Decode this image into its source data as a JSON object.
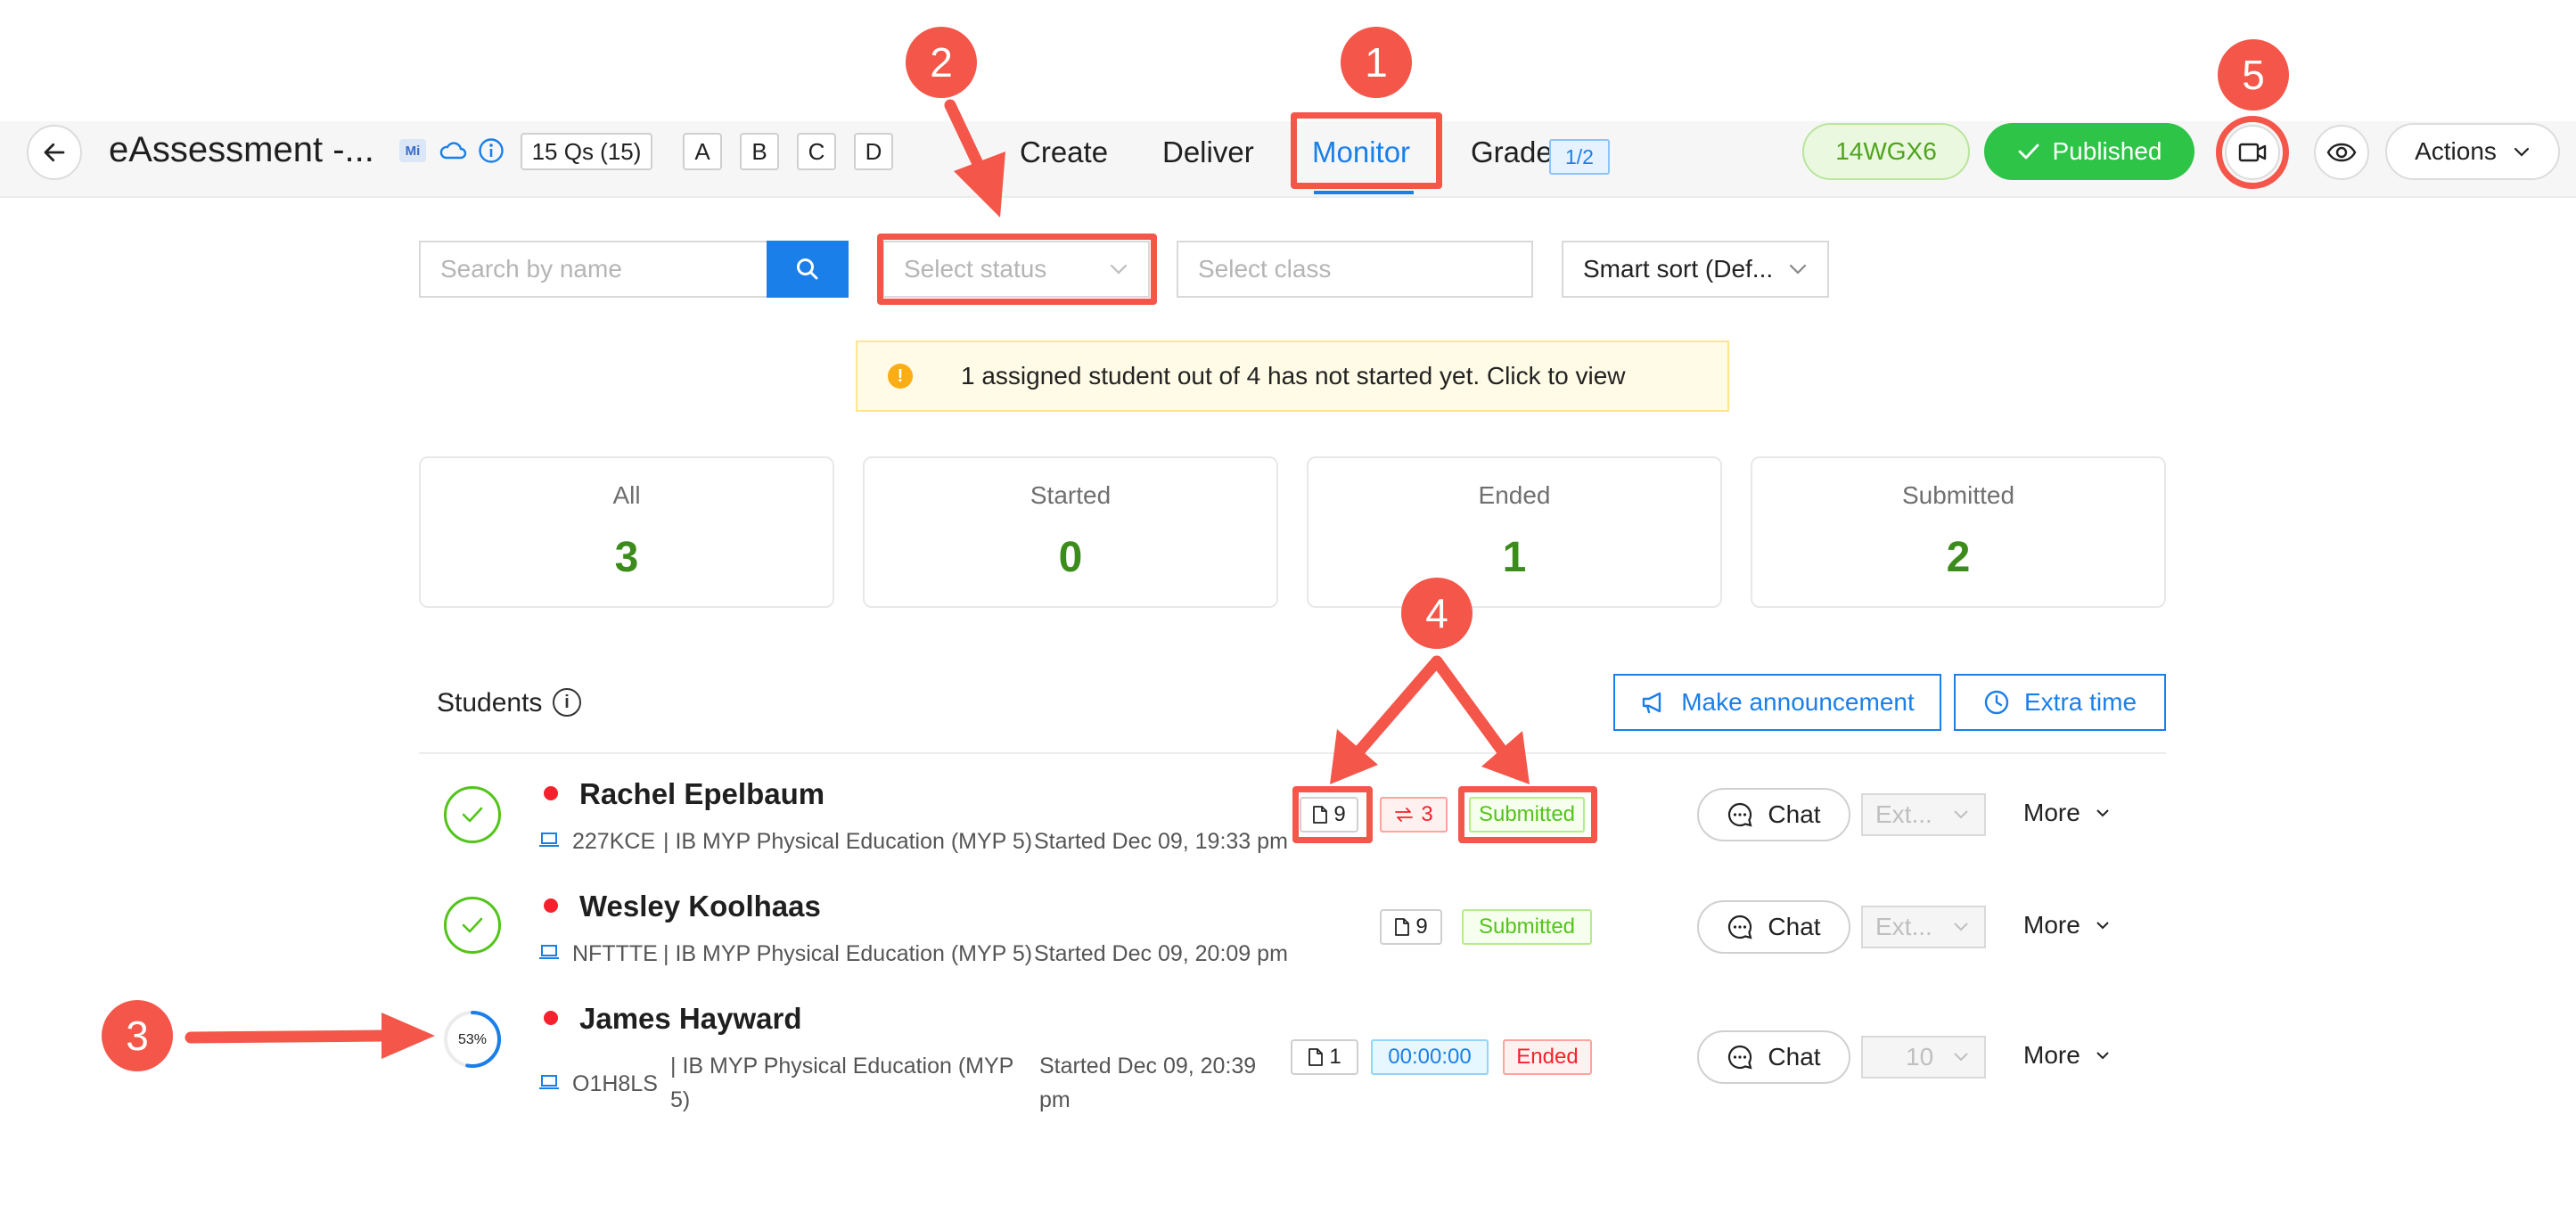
{
  "header": {
    "title": "eAssessment -...",
    "mi_badge": "Mi",
    "questions_chip": "15 Qs (15)",
    "choices": [
      "A",
      "B",
      "C",
      "D"
    ],
    "tabs": [
      {
        "label": "Create",
        "active": false
      },
      {
        "label": "Deliver",
        "active": false
      },
      {
        "label": "Monitor",
        "active": true
      },
      {
        "label": "Grade",
        "active": false
      }
    ],
    "grade_badge": "1/2",
    "code": "14WGX6",
    "published_label": "Published",
    "actions_label": "Actions"
  },
  "filters": {
    "search_placeholder": "Search by name",
    "status_placeholder": "Select status",
    "class_placeholder": "Select class",
    "sort_value": "Smart sort (Def..."
  },
  "notice": {
    "icon": "!",
    "text": "1 assigned student out of 4 has not started yet. Click to view"
  },
  "stats": [
    {
      "label": "All",
      "value": "3"
    },
    {
      "label": "Started",
      "value": "0"
    },
    {
      "label": "Ended",
      "value": "1"
    },
    {
      "label": "Submitted",
      "value": "2"
    }
  ],
  "students_section": {
    "title": "Students",
    "info_icon": "i",
    "announcement_label": "Make announcement",
    "extra_time_label": "Extra time"
  },
  "students": [
    {
      "name": "Rachel Epelbaum",
      "code": "227KCE",
      "class": "| IB MYP Physical Education (MYP 5)",
      "started": "Started Dec 09, 19:33 pm",
      "docs": "9",
      "switches": "3",
      "status": "Submitted",
      "chat": "Chat",
      "ext": "Ext...",
      "more": "More"
    },
    {
      "name": "Wesley Koolhaas",
      "code": "NFTTTE",
      "class": "| IB MYP Physical Education (MYP 5)",
      "started": "Started Dec 09, 20:09 pm",
      "docs": "9",
      "status": "Submitted",
      "chat": "Chat",
      "ext": "Ext...",
      "more": "More"
    },
    {
      "name": "James Hayward",
      "code": "O1H8LS",
      "class_line1": "| IB MYP Physical Education (MYP",
      "class_line2": "5)",
      "started_line1": "Started Dec 09, 20:39",
      "started_line2": "pm",
      "progress_label": "53%",
      "progress": 0.53,
      "docs": "1",
      "timer": "00:00:00",
      "status": "Ended",
      "chat": "Chat",
      "ext": "10",
      "more": "More"
    }
  ],
  "annotations": [
    "1",
    "2",
    "3",
    "4",
    "5"
  ],
  "colors": {
    "accent": "#1a7fe8",
    "published": "#2ec447",
    "stat_value": "#3c8c1c",
    "annotation": "#f4564a"
  }
}
